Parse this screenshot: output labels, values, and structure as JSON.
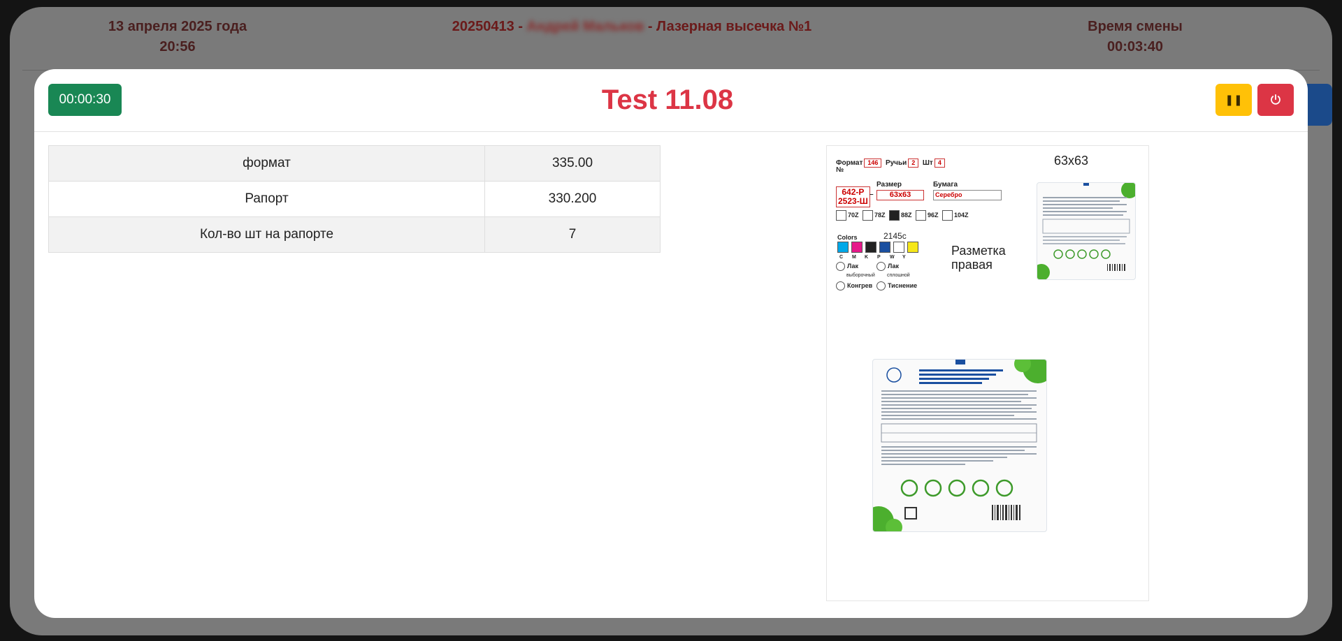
{
  "header": {
    "date": "13 апреля 2025 года",
    "time": "20:56",
    "job_id": "20250413",
    "operator": "Андрей Мальков",
    "separator": "-",
    "machine": "Лазерная высечка №1",
    "shift_label": "Время смены",
    "shift_time": "00:03:40"
  },
  "modal": {
    "timer": "00:00:30",
    "title": "Test 11.08",
    "pause_icon": "pause-icon",
    "power_icon": "power-icon"
  },
  "params": [
    {
      "label": "формат",
      "value": "335.00"
    },
    {
      "label": "Рапорт",
      "value": "330.200"
    },
    {
      "label": "Кол-во шт на рапорте",
      "value": "7"
    }
  ],
  "spec": {
    "format_label": "Формат",
    "format_value": "146",
    "handles_label": "Ручьи",
    "handles_value": "2",
    "pcs_label": "Шт",
    "pcs_value": "4",
    "num_label": "№",
    "num_value_1": "642-Р",
    "num_value_2": "2523-Ш",
    "dash": "–",
    "size_label": "Размер",
    "size_value": "63x63",
    "paper_label": "Бумага",
    "paper_value": "Серебро",
    "checks": [
      "70Z",
      "78Z",
      "88Z",
      "96Z",
      "104Z"
    ],
    "colors_label": "Colors",
    "color_code": "2145c",
    "swatch_letters": [
      "C",
      "M",
      "K",
      "P",
      "W",
      "Y"
    ],
    "swatch_colors": [
      "#00a8e8",
      "#e6198a",
      "#222222",
      "#1a4fa0",
      "#ffffff",
      "#f6e71a"
    ],
    "lak_vyb": "Лак",
    "lak_vyb_sub": "выборочный",
    "lak_spl": "Лак",
    "lak_spl_sub": "сплошной",
    "kongrev": "Конгрев",
    "tisnenie": "Тиснение",
    "markup_label": "Разметка правая",
    "size_title": "63х63"
  }
}
